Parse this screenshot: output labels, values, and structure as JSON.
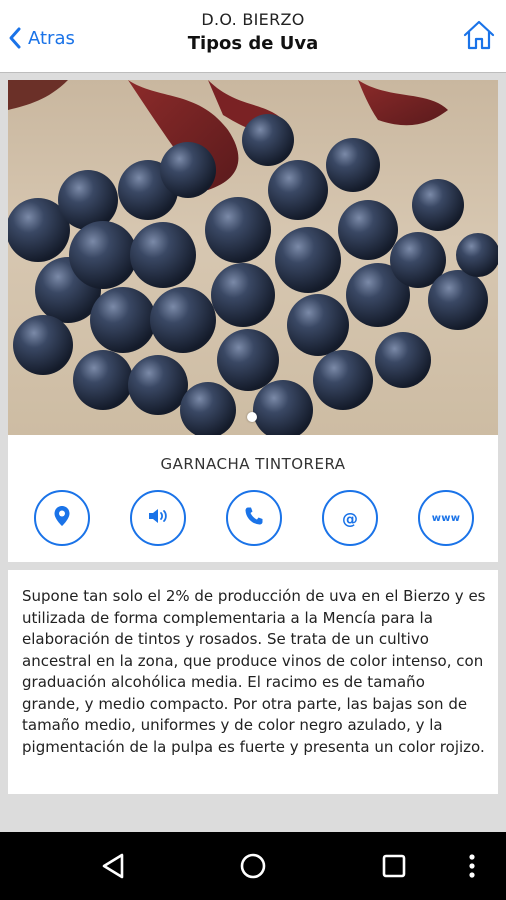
{
  "header": {
    "back_label": "Atras",
    "subtitle": "D.O. BIERZO",
    "title": "Tipos de Uva"
  },
  "grape": {
    "name": "GARNACHA TINTORERA",
    "description": "Supone tan solo el 2% de producción de uva en el Bierzo y es utilizada de forma complementaria a la Mencía para la elaboración de tintos y rosados. Se trata de un cultivo ancestral en la zona, que produce vinos de color intenso, con graduación alcohólica media. El racimo es de tamaño grande, y medio compacto. Por otra parte, las bajas son de tamaño medio, uniformes y de color negro azulado, y la pigmentación de la pulpa es fuerte y presenta un color rojizo."
  },
  "actions": {
    "email_glyph": "@",
    "web_glyph": "www"
  },
  "carousel": {
    "current_page": 1,
    "total_pages": 1
  },
  "colors": {
    "accent": "#1a73e8",
    "background": "#dcdcdc",
    "navbar": "#000000"
  },
  "icons": [
    "chevron-left-icon",
    "home-icon",
    "location-pin-icon",
    "speaker-icon",
    "phone-icon",
    "email-icon",
    "web-icon",
    "nav-back-icon",
    "nav-home-icon",
    "nav-recents-icon",
    "nav-menu-icon"
  ]
}
